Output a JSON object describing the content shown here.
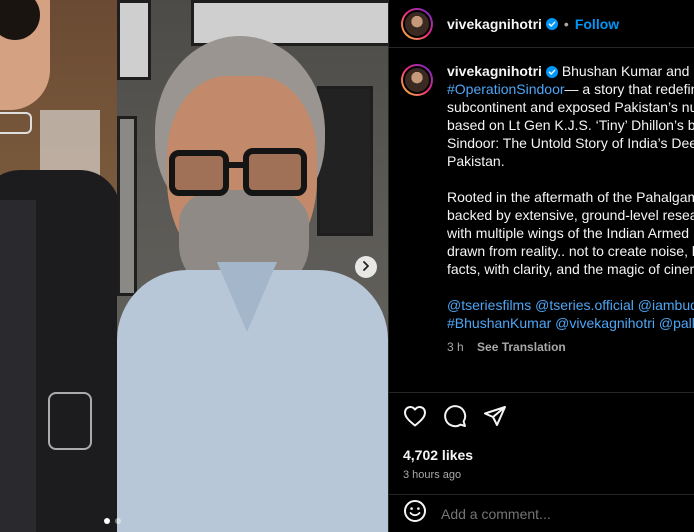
{
  "header": {
    "username": "vivekagnihotri",
    "separator": "•",
    "follow_label": "Follow"
  },
  "caption": {
    "username": "vivekagnihotri",
    "line1": "Bhushan Kumar and I ha",
    "line2_tag": "#OperationSindoor",
    "line2_rest": "— a story that redefine",
    "line3": "subcontinent and exposed Pakistan’s nuc",
    "line4": "based on Lt Gen K.J.S. ‘Tiny’ Dhillon’s boo",
    "line5": "Sindoor: The Untold Story of India’s Deep",
    "line6": "Pakistan.",
    "para2_line1": "Rooted in the aftermath of the Pahalgam",
    "para2_line2": "backed by extensive, ground-level resear",
    "para2_line3": "with multiple wings of the Indian Armed F",
    "para2_line4": "drawn from reality.. not to create noise, b",
    "para2_line5": "facts, with clarity, and the magic of cinem",
    "mentions_line1": "@tseriesfilms @tseries.official @iambudd",
    "mentions_line2": "#BhushanKumar @vivekagnihotri @pallav",
    "posted_ago": "3 h",
    "see_translation": "See Translation"
  },
  "engagement": {
    "likes": "4,702 likes",
    "time_ago": "3 hours ago"
  },
  "comment": {
    "placeholder": "Add a comment..."
  },
  "icons": {
    "verified": "verified-badge-icon",
    "like": "heart-icon",
    "comment": "comment-icon",
    "share": "send-icon",
    "emoji": "emoji-icon",
    "next": "chevron-right-icon"
  },
  "colors": {
    "accent": "#0095f6",
    "hashtag": "#4ea6f5",
    "muted": "#a8a8a8"
  }
}
